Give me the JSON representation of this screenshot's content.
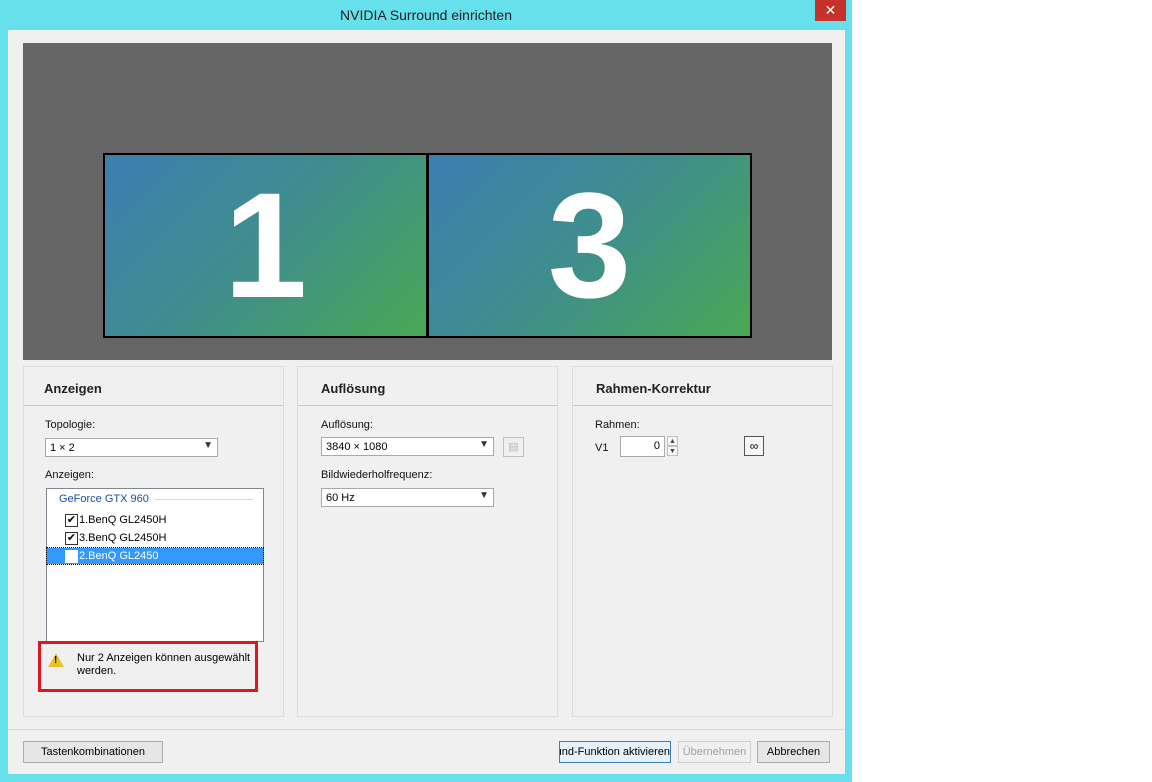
{
  "window": {
    "title": "NVIDIA Surround einrichten",
    "close_label": "✕"
  },
  "preview": {
    "monitors": [
      "1",
      "3"
    ]
  },
  "anzeigen": {
    "title": "Anzeigen",
    "topology_label": "Topologie:",
    "topology_value": "1 × 2",
    "displays_label": "Anzeigen:",
    "gpu_name": "GeForce GTX 960",
    "items": [
      {
        "label": "1.BenQ GL2450H",
        "checked": true,
        "selected": false
      },
      {
        "label": "3.BenQ GL2450H",
        "checked": true,
        "selected": false
      },
      {
        "label": "2.BenQ GL2450",
        "checked": false,
        "selected": true
      }
    ],
    "warning": "Nur 2 Anzeigen können ausgewählt werden."
  },
  "aufloesung": {
    "title": "Auflösung",
    "resolution_label": "Auflösung:",
    "resolution_value": "3840 × 1080",
    "refresh_label": "Bildwiederholfrequenz:",
    "refresh_value": "60  Hz"
  },
  "rahmen": {
    "title": "Rahmen-Korrektur",
    "rahmen_label": "Rahmen:",
    "v1_label": "V1",
    "v1_value": "0"
  },
  "footer": {
    "shortcuts": "Tastenkombinationen",
    "activate": "round-Funktion aktivieren",
    "apply": "Übernehmen",
    "cancel": "Abbrechen"
  },
  "icons": {
    "warning": "warning-icon",
    "link": "link-icon",
    "aspect": "bezel-icon",
    "dropdown": "chevron-down-icon"
  },
  "colors": {
    "title_bar": "#66e0ea",
    "close_button": "#c7312b",
    "preview_bg": "#666666",
    "selection": "#3399ff",
    "warning_border": "#e0161f"
  }
}
